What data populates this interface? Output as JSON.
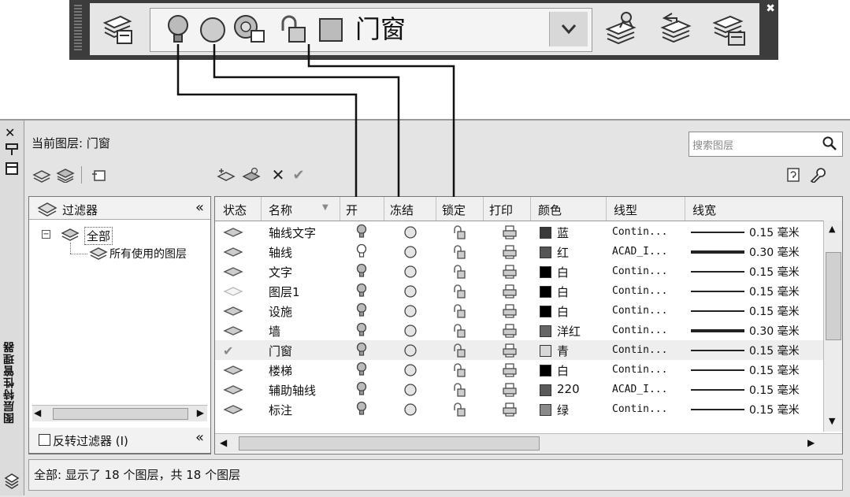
{
  "toolbar": {
    "current_layer_name": "门窗",
    "icons": [
      "layer-properties-icon",
      "layer-on-icon",
      "layer-freeze-icon",
      "layer-freeze-viewport-icon",
      "layer-lock-icon",
      "layer-color-icon",
      "make-current-icon",
      "layer-previous-icon",
      "layer-state-icon"
    ]
  },
  "panel": {
    "title": "图层特性管理器",
    "current_layer": "当前图层: 门窗",
    "search_placeholder": "搜索图层",
    "status": "全部: 显示了 18 个图层，共 18 个图层"
  },
  "filters": {
    "title": "过滤器",
    "tree": [
      {
        "label": "全部"
      },
      {
        "label": "所有使用的图层"
      }
    ],
    "invert_label": "反转过滤器 (I)",
    "invert_checked": false
  },
  "table": {
    "columns": [
      "状态",
      "名称",
      "开",
      "冻结",
      "锁定",
      "打印",
      "颜色",
      "线型",
      "线宽"
    ],
    "rows": [
      {
        "status": "layer",
        "name": "轴线文字",
        "on": true,
        "color_name": "蓝",
        "color_hex": "#3a3a3a",
        "linetype": "Contin...",
        "lineweight": "0.15 毫米",
        "lw_bold": false
      },
      {
        "status": "layer",
        "name": "轴线",
        "on": false,
        "color_name": "红",
        "color_hex": "#555555",
        "linetype": "ACAD_I...",
        "lineweight": "0.30 毫米",
        "lw_bold": true
      },
      {
        "status": "layer",
        "name": "文字",
        "on": true,
        "color_name": "白",
        "color_hex": "#000000",
        "linetype": "Contin...",
        "lineweight": "0.15 毫米",
        "lw_bold": false
      },
      {
        "status": "empty",
        "name": "图层1",
        "on": true,
        "color_name": "白",
        "color_hex": "#000000",
        "linetype": "Contin...",
        "lineweight": "0.15 毫米",
        "lw_bold": false
      },
      {
        "status": "layer",
        "name": "设施",
        "on": true,
        "color_name": "白",
        "color_hex": "#000000",
        "linetype": "Contin...",
        "lineweight": "0.15 毫米",
        "lw_bold": false
      },
      {
        "status": "layer",
        "name": "墙",
        "on": true,
        "color_name": "洋红",
        "color_hex": "#666666",
        "linetype": "Contin...",
        "lineweight": "0.30 毫米",
        "lw_bold": true
      },
      {
        "status": "current",
        "name": "门窗",
        "on": true,
        "color_name": "青",
        "color_hex": "#d8d8d8",
        "linetype": "Contin...",
        "lineweight": "0.15 毫米",
        "lw_bold": false
      },
      {
        "status": "layer",
        "name": "楼梯",
        "on": true,
        "color_name": "白",
        "color_hex": "#000000",
        "linetype": "Contin...",
        "lineweight": "0.15 毫米",
        "lw_bold": false
      },
      {
        "status": "layer",
        "name": "辅助轴线",
        "on": true,
        "color_name": "220",
        "color_hex": "#5a5a5a",
        "linetype": "ACAD_I...",
        "lineweight": "0.15 毫米",
        "lw_bold": false
      },
      {
        "status": "layer",
        "name": "标注",
        "on": true,
        "color_name": "绿",
        "color_hex": "#8a8a8a",
        "linetype": "Contin...",
        "lineweight": "0.15 毫米",
        "lw_bold": false
      }
    ]
  }
}
